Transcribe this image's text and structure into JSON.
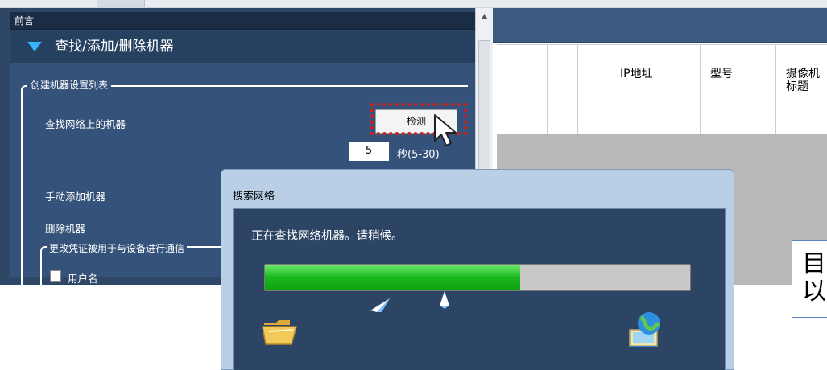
{
  "left_panel": {
    "preface_label": "前言",
    "section_title": "查找/添加/删除机器",
    "group_title": "创建机器设置列表",
    "find_label": "查找网络上的机器",
    "detect_button": "检测",
    "seconds_value": "5",
    "seconds_unit": "秒(5-30)",
    "manual_add_label": "手动添加机器",
    "delete_label": "删除机器",
    "credentials_title": "更改凭证被用于与设备进行通信",
    "username_label": "用户名"
  },
  "table": {
    "columns": [
      "",
      "",
      "",
      "IP地址",
      "型号",
      "摄像机\n标题"
    ]
  },
  "note": {
    "text": "目\n以"
  },
  "dialog": {
    "title": "搜索网络",
    "message": "正在查找网络机器。请稍候。",
    "progress_fraction": 0.6
  },
  "icons": {
    "scroll_up": "scroll-up-arrow-icon",
    "folder": "folder-icon",
    "paper_plane": "flying-document-icon",
    "network_computer": "network-computer-icon",
    "cursor": "mouse-pointer-icon",
    "section_toggle": "expand-triangle-icon"
  },
  "colors": {
    "panel_bg": "#35527a",
    "header_bg": "#26405f",
    "accent": "#37b3ff",
    "highlight": "#d0201a",
    "progress_green": "#19b81c"
  }
}
